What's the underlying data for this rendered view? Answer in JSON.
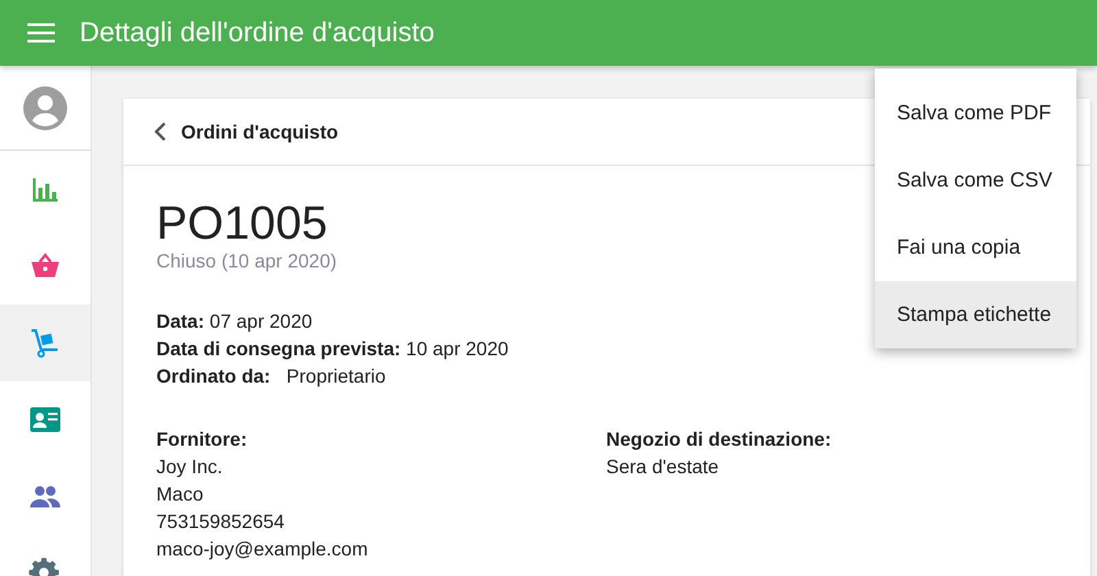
{
  "app_bar": {
    "title": "Dettagli dell'ordine d'acquisto"
  },
  "sidebar": {
    "items": [
      {
        "kind": "chart",
        "color": "#4caf50",
        "selected": false
      },
      {
        "kind": "basket",
        "color": "#ec407a",
        "selected": false
      },
      {
        "kind": "truck",
        "color": "#039be5",
        "selected": true
      },
      {
        "kind": "contact",
        "color": "#009688",
        "selected": false
      },
      {
        "kind": "people",
        "color": "#5c6bc0",
        "selected": false
      },
      {
        "kind": "gear",
        "color": "#546e7a",
        "selected": false
      }
    ]
  },
  "card": {
    "back_link": "Ordini d'acquisto",
    "order_number": "PO1005",
    "status": "Chiuso (10 apr 2020)",
    "details": [
      "**Data:** 07 apr 2020",
      "**Data di consegna prevista:** 10 apr 2020",
      "**Ordinato da:**   Proprietario"
    ],
    "columns": [
      {
        "heading": "Fornitore:",
        "lines": [
          "Joy Inc.",
          "Maco",
          "753159852654",
          "maco-joy@example.com"
        ]
      },
      {
        "heading": "Negozio di destinazione:",
        "lines": [
          "Sera d'estate"
        ]
      }
    ]
  },
  "menu": {
    "items": [
      {
        "label": "Salva come PDF",
        "selected": false
      },
      {
        "label": "Salva come CSV",
        "selected": false
      },
      {
        "label": "Fai una copia",
        "selected": false
      },
      {
        "label": "Stampa etichette",
        "selected": true
      }
    ]
  }
}
